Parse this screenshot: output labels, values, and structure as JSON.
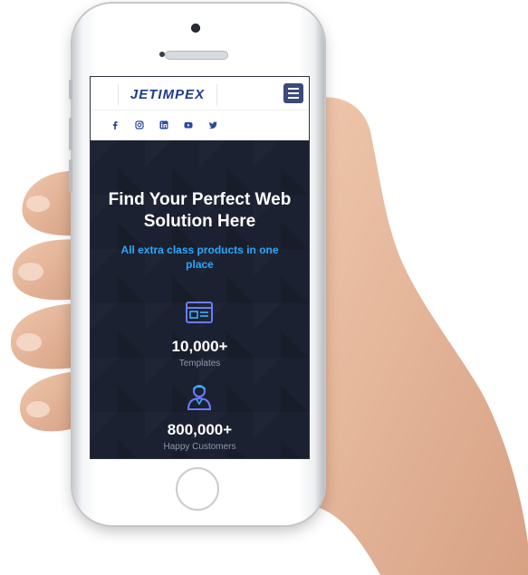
{
  "site": {
    "logo_text": "JETIMPEX"
  },
  "header": {
    "menu_icon": "hamburger-menu-icon",
    "socials": [
      {
        "icon": "facebook-icon"
      },
      {
        "icon": "instagram-icon"
      },
      {
        "icon": "linkedin-icon"
      },
      {
        "icon": "youtube-icon"
      },
      {
        "icon": "twitter-icon"
      }
    ]
  },
  "hero": {
    "title_line1": "Find Your Perfect Web",
    "title_line2": "Solution Here",
    "subtitle_line1": "All extra class products in one",
    "subtitle_line2": "place"
  },
  "stats": [
    {
      "icon": "template-window-icon",
      "value": "10,000+",
      "label": "Templates"
    },
    {
      "icon": "customer-person-icon",
      "value": "800,000+",
      "label": "Happy Customers"
    }
  ],
  "colors": {
    "accent": "#2aa6ff",
    "hero_bg": "#1b2130",
    "menu_button": "#3b4a7a",
    "logo": "#1f3b8a"
  }
}
